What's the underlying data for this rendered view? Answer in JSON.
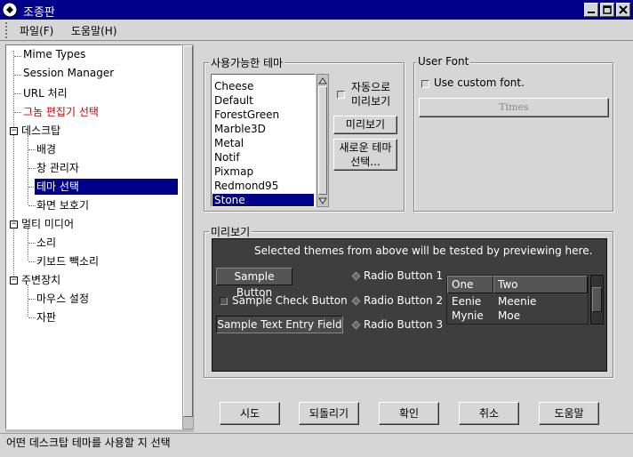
{
  "window": {
    "title": "조종판"
  },
  "menu": {
    "items": [
      "파일(F)",
      "도움말(H)"
    ]
  },
  "tree": {
    "items": [
      {
        "label": "Mime Types",
        "indent": 1,
        "highlight": false,
        "selected": false,
        "expander": ""
      },
      {
        "label": "Session Manager",
        "indent": 1,
        "highlight": false,
        "selected": false,
        "expander": ""
      },
      {
        "label": "URL 처리",
        "indent": 1,
        "highlight": false,
        "selected": false,
        "expander": ""
      },
      {
        "label": "그놈 편집기 선택",
        "indent": 1,
        "highlight": true,
        "selected": false,
        "expander": ""
      },
      {
        "label": "데스크탑",
        "indent": 0,
        "highlight": false,
        "selected": false,
        "expander": "−"
      },
      {
        "label": "배경",
        "indent": 2,
        "highlight": false,
        "selected": false,
        "expander": ""
      },
      {
        "label": "창 관리자",
        "indent": 2,
        "highlight": false,
        "selected": false,
        "expander": ""
      },
      {
        "label": "테마 선택",
        "indent": 2,
        "highlight": false,
        "selected": true,
        "expander": ""
      },
      {
        "label": "화면 보호기",
        "indent": 2,
        "highlight": false,
        "selected": false,
        "expander": ""
      },
      {
        "label": "멀티 미디어",
        "indent": 0,
        "highlight": false,
        "selected": false,
        "expander": "−"
      },
      {
        "label": "소리",
        "indent": 2,
        "highlight": false,
        "selected": false,
        "expander": ""
      },
      {
        "label": "키보드 빽소리",
        "indent": 2,
        "highlight": false,
        "selected": false,
        "expander": ""
      },
      {
        "label": "주변장치",
        "indent": 0,
        "highlight": false,
        "selected": false,
        "expander": "−"
      },
      {
        "label": "마우스 설정",
        "indent": 2,
        "highlight": false,
        "selected": false,
        "expander": ""
      },
      {
        "label": "자판",
        "indent": 2,
        "highlight": false,
        "selected": false,
        "expander": ""
      }
    ]
  },
  "themes": {
    "label": "사용가능한 테마",
    "list": [
      "Cheese",
      "Default",
      "ForestGreen",
      "Marble3D",
      "Metal",
      "Notif",
      "Pixmap",
      "Redmond95",
      "Stone"
    ],
    "selected": "Stone",
    "auto_preview_line1": "자동으로",
    "auto_preview_line2": "미리보기",
    "preview_button": "미리보기",
    "new_theme_line1": "새로운 테마",
    "new_theme_line2": "선택..."
  },
  "user_font": {
    "label": "User Font",
    "use_custom": "Use custom font.",
    "font_button": "Times"
  },
  "preview": {
    "label": "미리보기",
    "caption": "Selected themes from above will be tested by previewing here.",
    "sample_button": "Sample Button",
    "sample_check": "Sample Check Button",
    "sample_entry": "Sample Text Entry Field",
    "radio1": "Radio Button 1",
    "radio2": "Radio Button 2",
    "radio3": "Radio Button 3",
    "col1": "One",
    "col2": "Two",
    "rows": [
      [
        "Eenie",
        "Meenie"
      ],
      [
        "Mynie",
        "Moe"
      ]
    ]
  },
  "buttons": {
    "try": "시도",
    "revert": "되돌리기",
    "ok": "확인",
    "cancel": "취소",
    "help": "도움말"
  },
  "status": {
    "text": "어떤 데스크탑 테마를 사용할 지 선택"
  },
  "colors": {
    "title_bg": "#00008b",
    "selection": "#00008b",
    "highlight_text": "#cc0000"
  }
}
